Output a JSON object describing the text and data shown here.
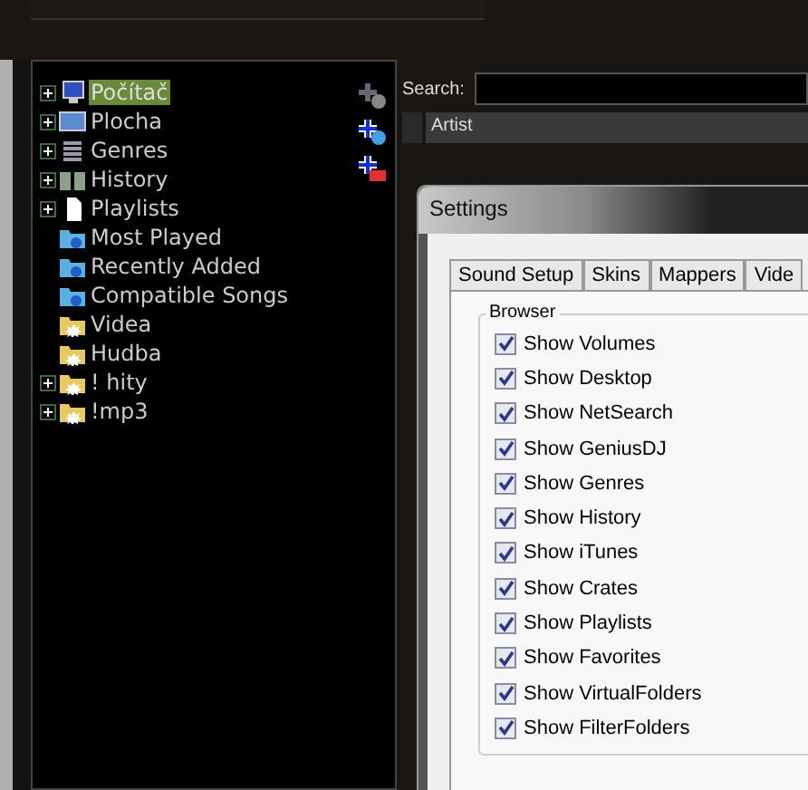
{
  "tree": {
    "items": [
      {
        "label": "Počítač",
        "kind": "computer",
        "expandable": true,
        "selected": true
      },
      {
        "label": "Plocha",
        "kind": "desktop",
        "expandable": true,
        "selected": false
      },
      {
        "label": "Genres",
        "kind": "genres",
        "expandable": true,
        "selected": false
      },
      {
        "label": "History",
        "kind": "history",
        "expandable": true,
        "selected": false
      },
      {
        "label": "Playlists",
        "kind": "playlist",
        "expandable": true,
        "selected": false
      },
      {
        "label": "Most Played",
        "kind": "smartfolder",
        "expandable": false,
        "selected": false
      },
      {
        "label": "Recently Added",
        "kind": "smartfolder",
        "expandable": false,
        "selected": false
      },
      {
        "label": "Compatible Songs",
        "kind": "smartfolder",
        "expandable": false,
        "selected": false
      },
      {
        "label": "Videa",
        "kind": "folder",
        "expandable": false,
        "selected": false
      },
      {
        "label": "Hudba",
        "kind": "folder",
        "expandable": false,
        "selected": false
      },
      {
        "label": "! hity",
        "kind": "folder",
        "expandable": true,
        "selected": false
      },
      {
        "label": "!mp3",
        "kind": "folder",
        "expandable": true,
        "selected": false
      }
    ]
  },
  "search": {
    "label": "Search:"
  },
  "list": {
    "columns": [
      "Artist"
    ]
  },
  "settings": {
    "title": "Settings",
    "tabs": [
      {
        "label": "Sound Setup",
        "selected": false
      },
      {
        "label": "Skins",
        "selected": false
      },
      {
        "label": "Mappers",
        "selected": false
      },
      {
        "label": "Vide",
        "selected": false
      }
    ],
    "group": "Browser",
    "options": [
      {
        "label": "Show Volumes",
        "checked": true
      },
      {
        "label": "Show Desktop",
        "checked": true
      },
      {
        "label": "Show NetSearch",
        "checked": true
      },
      {
        "label": "Show GeniusDJ",
        "checked": true
      },
      {
        "label": "Show Genres",
        "checked": true
      },
      {
        "label": "Show History",
        "checked": true
      },
      {
        "label": "Show iTunes",
        "checked": true
      },
      {
        "label": "Show Crates",
        "checked": true
      },
      {
        "label": "Show Playlists",
        "checked": true
      },
      {
        "label": "Show Favorites",
        "checked": true
      },
      {
        "label": "Show VirtualFolders",
        "checked": true
      },
      {
        "label": "Show FilterFolders",
        "checked": true
      }
    ]
  }
}
